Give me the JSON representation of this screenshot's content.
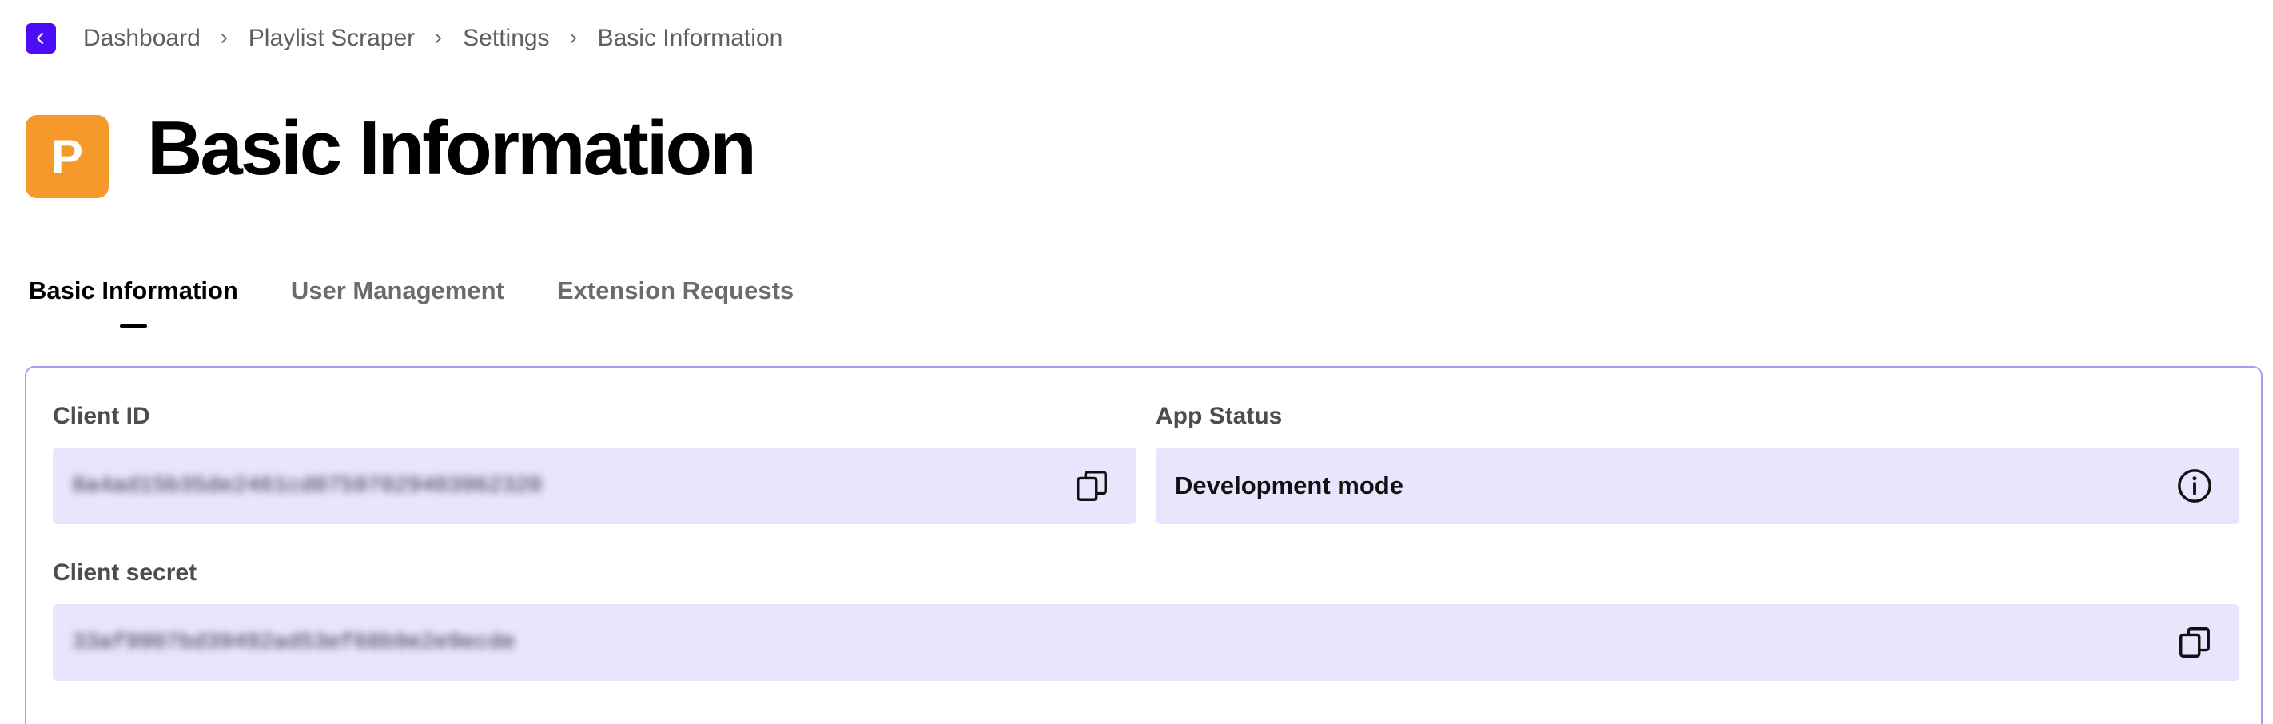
{
  "breadcrumb": {
    "back_icon": "chevron-left-icon",
    "items": [
      "Dashboard",
      "Playlist Scraper",
      "Settings",
      "Basic Information"
    ]
  },
  "header": {
    "app_icon_letter": "P",
    "title": "Basic Information"
  },
  "tabs": [
    {
      "label": "Basic Information",
      "active": true
    },
    {
      "label": "User Management",
      "active": false
    },
    {
      "label": "Extension Requests",
      "active": false
    }
  ],
  "fields": {
    "client_id": {
      "label": "Client ID",
      "value": "8a4ad15b35de2461cd07597029403962320",
      "action_icon": "copy-icon"
    },
    "app_status": {
      "label": "App Status",
      "value": "Development mode",
      "action_icon": "info-icon"
    },
    "client_secret": {
      "label": "Client secret",
      "value": "33af9907bd39492ad53ef68b9e2e9ecde",
      "action_icon": "copy-icon"
    }
  },
  "colors": {
    "accent": "#4b0df5",
    "app_icon": "#f59a2a",
    "field_background": "#eae5fc",
    "card_border": "#a99cf0"
  }
}
